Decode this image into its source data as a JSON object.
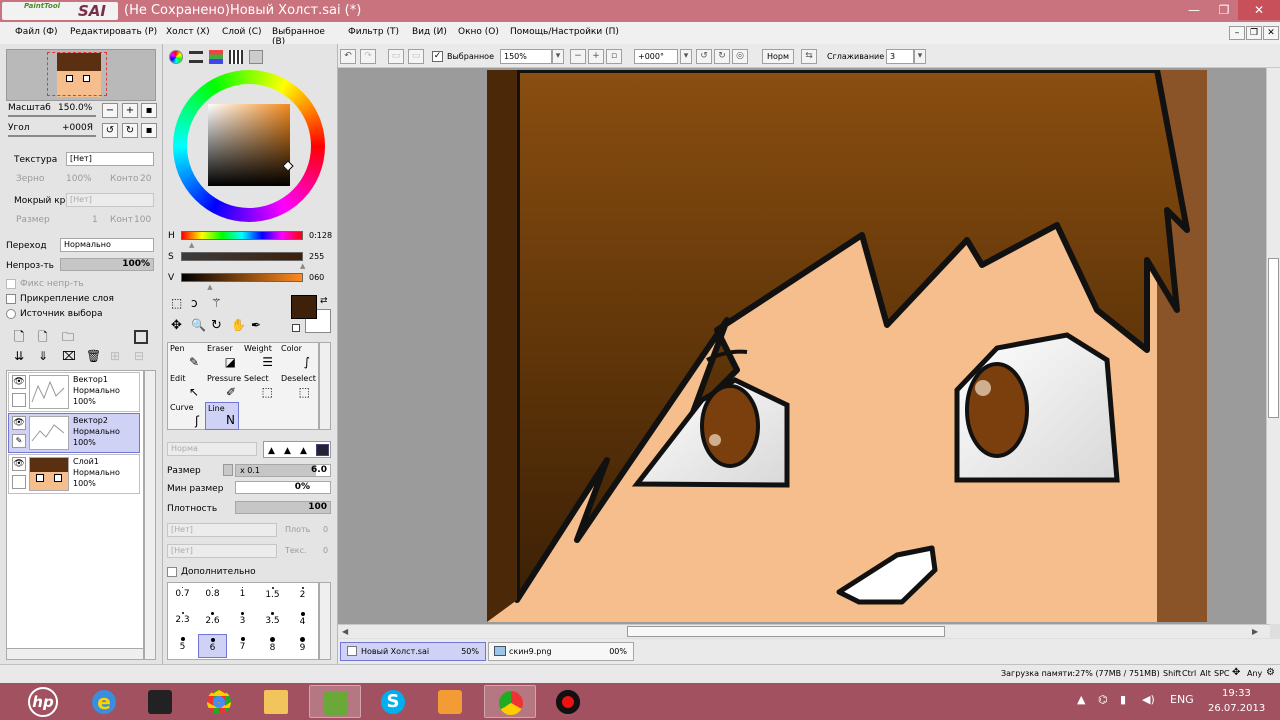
{
  "app": {
    "logo_small": "PaintTool",
    "logo_big": "SAI",
    "title": "(Не Сохранено)Новый Холст.sai (*)"
  },
  "window_controls": {
    "minimize": "—",
    "restore": "❐",
    "close": "✕"
  },
  "menu": [
    "Файл (Ф)",
    "Редактировать (Р)",
    "Холст (Х)",
    "Слой (С)",
    "Выбранное (В)",
    "Фильтр (Т)",
    "Вид (И)",
    "Окно (О)",
    "Помощь/Настройки (П)"
  ],
  "toolbar": {
    "selection_check_label": "Выбранное",
    "zoom": "150%",
    "angle": "+000°",
    "norm_btn": "Норм",
    "smoothing_label": "Сглаживание",
    "smoothing_value": "3"
  },
  "navigator": {
    "scale_label": "Масштаб",
    "scale_value": "150.0%",
    "angle_label": "Угол",
    "angle_value": "+000Я"
  },
  "texture": {
    "label": "Текстура",
    "value": "[Нет]",
    "grain_label": "Зерно",
    "grain_value": "100%",
    "contour_label": "Конто",
    "contour_value": "20"
  },
  "wet_edge": {
    "label": "Мокрый край",
    "value": "[Нет]",
    "size_label": "Размер",
    "size_value": "1",
    "contour_label": "Конт",
    "contour_value": "100"
  },
  "blend": {
    "label": "Переход",
    "value": "Нормально"
  },
  "opacity": {
    "label": "Непроз-ть",
    "value": "100%",
    "fraction": 1.0
  },
  "checks": {
    "fix_opacity": "Фикс непр-ть",
    "clip_layer": "Прикрепление слоя",
    "selection_source": "Источник выбора"
  },
  "layers": [
    {
      "name": "Вектор1",
      "mode": "Нормально",
      "opacity": "100%"
    },
    {
      "name": "Вектор2",
      "mode": "Нормально",
      "opacity": "100%"
    },
    {
      "name": "Слой1",
      "mode": "Нормально",
      "opacity": "100%"
    }
  ],
  "color": {
    "h_label": "H",
    "h_value": "0:128",
    "s_label": "S",
    "s_value": "255",
    "v_label": "V",
    "v_value": "060",
    "h_fraction": 0.09,
    "s_fraction": 1.0,
    "v_fraction": 0.24,
    "fg": "#3f200a",
    "bg": "#ffffff"
  },
  "tools": [
    "Pen",
    "Eraser",
    "Weight",
    "Color",
    "Edit",
    "Pressure",
    "Select",
    "Deselect",
    "Curve",
    "Line"
  ],
  "brush": {
    "mode": "Норма",
    "size_label": "Размер",
    "size_mult": "x 0.1",
    "size_value": "6.0",
    "size_fraction": 0.85,
    "min_label": "Мин размер",
    "min_value": "0%",
    "density_label": "Плотность",
    "density_value": "100",
    "density_fraction": 1.0,
    "dd1": "[Нет]",
    "dd1_side": "Плоть",
    "dd1_value": "0",
    "dd2": "[Нет]",
    "dd2_side": "Текс.",
    "dd2_value": "0",
    "extra": "Дополнительно"
  },
  "brush_sizes": [
    "0.7",
    "0.8",
    "1",
    "1.5",
    "2",
    "2.3",
    "2.6",
    "3",
    "3.5",
    "4",
    "5",
    "6",
    "7",
    "8",
    "9"
  ],
  "file_tabs": [
    {
      "name": "Новый Холст.sai",
      "pct": "50%"
    },
    {
      "name": "скин9.png",
      "pct": "00%"
    }
  ],
  "status": {
    "memory": "Загрузка памяти:27% (77MB / 751MB)",
    "keys": [
      "Shift",
      "Ctrl",
      "Alt",
      "SPC"
    ],
    "any": "Any"
  },
  "tray": {
    "lang": "ENG",
    "time": "19:33",
    "date": "26.07.2013"
  },
  "colors": {
    "hair": "#4d2a08",
    "skin": "#f5be8c",
    "eye": "#7a3f0c",
    "outline": "#111111"
  }
}
